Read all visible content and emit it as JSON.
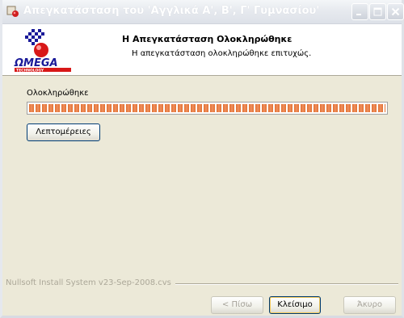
{
  "window": {
    "title": "Απεγκατάσταση του 'Αγγλικά Α', Β', Γ' Γυμνασίου'",
    "icons": {
      "app": "installer-icon",
      "minimize": "minimize-icon",
      "maximize": "maximize-icon",
      "close": "close-icon"
    }
  },
  "header": {
    "title": "Η Απεγκατάσταση Ολοκληρώθηκε",
    "subtitle": "Η απεγκατάσταση ολοκληρώθηκε επιτυχώς.",
    "logo": "OMEGA TECHNOLOGY"
  },
  "main": {
    "status_label": "Ολοκληρώθηκε",
    "progress": 1.0,
    "details_label": "Λεπτομέρειες"
  },
  "footer": {
    "branding": "Nullsoft Install System v23-Sep-2008.cvs",
    "back_label": "< Πίσω",
    "close_label": "Κλείσιμο",
    "cancel_label": "Άκυρο"
  },
  "colors": {
    "progress": "#e07030",
    "titlebar": "#e7eaef",
    "background": "#ece9d8"
  }
}
